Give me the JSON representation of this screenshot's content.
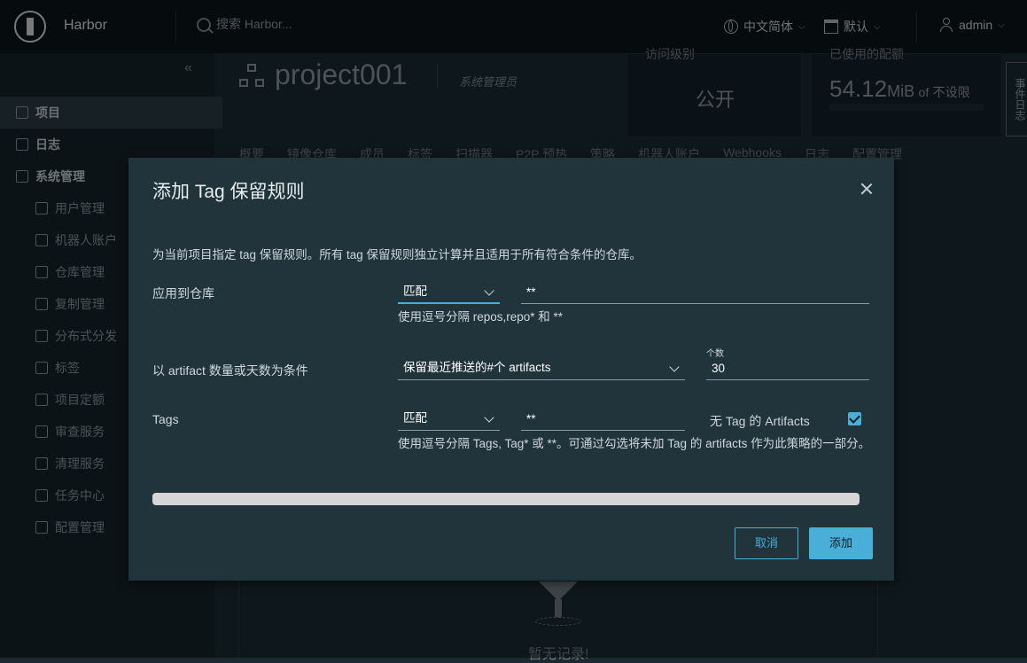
{
  "header": {
    "app_name": "Harbor",
    "search_placeholder": "搜索 Harbor...",
    "language": "中文简体",
    "date_format": "默认",
    "user": "admin"
  },
  "sidebar": {
    "items": [
      {
        "label": "项目",
        "active": true
      },
      {
        "label": "日志"
      },
      {
        "label": "系统管理"
      }
    ],
    "sub_items": [
      {
        "label": "用户管理"
      },
      {
        "label": "机器人账户"
      },
      {
        "label": "仓库管理"
      },
      {
        "label": "复制管理"
      },
      {
        "label": "分布式分发"
      },
      {
        "label": "标签"
      },
      {
        "label": "项目定额"
      },
      {
        "label": "审查服务"
      },
      {
        "label": "清理服务"
      },
      {
        "label": "任务中心"
      },
      {
        "label": "配置管理"
      }
    ]
  },
  "project": {
    "name": "project001",
    "role": "系统管理员",
    "access_label": "访问级别",
    "access_value": "公开",
    "quota_label": "已使用的配额",
    "quota_value": "54.12",
    "quota_unit": "MiB",
    "quota_of": "of",
    "quota_limit": "不设限",
    "side_tab": "事件日志",
    "tabs": [
      "概要",
      "镜像仓库",
      "成员",
      "标签",
      "扫描器",
      "P2P 预热",
      "策略",
      "机器人账户",
      "Webhooks",
      "日志",
      "配置管理"
    ],
    "empty_text": "暂无记录!"
  },
  "modal": {
    "title": "添加 Tag 保留规则",
    "description": "为当前项目指定 tag 保留规则。所有 tag 保留规则独立计算并且适用于所有符合条件的仓库。",
    "repo_label": "应用到仓库",
    "repo_match": "匹配",
    "repo_pattern": "**",
    "repo_helper": "使用逗号分隔 repos,repo* 和 **",
    "condition_label": "以 artifact 数量或天数为条件",
    "condition_value": "保留最近推送的#个 artifacts",
    "count_label": "个数",
    "count_value": "30",
    "tags_label": "Tags",
    "tags_match": "匹配",
    "tags_pattern": "**",
    "untagged_label": "无 Tag 的 Artifacts",
    "untagged_checked": true,
    "tags_helper": "使用逗号分隔 Tags, Tag* 或 **。可通过勾选将未加 Tag 的 artifacts 作为此策略的一部分。",
    "cancel": "取消",
    "add": "添加"
  },
  "colors": {
    "accent": "#49aed8",
    "modal_bg": "#21333b",
    "header_bg": "#0b1419"
  }
}
